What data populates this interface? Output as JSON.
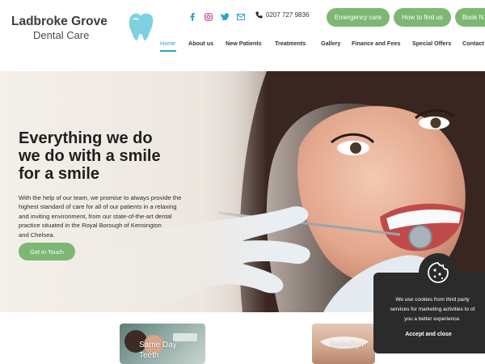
{
  "brand": {
    "name": "Ladbroke Grove",
    "subtitle": "Dental Care"
  },
  "social": [
    "facebook-icon",
    "instagram-icon",
    "twitter-icon",
    "email-icon"
  ],
  "phone": {
    "icon": "phone-icon",
    "number": "0207 727 9836"
  },
  "header_buttons": {
    "emergency": "Emergency care",
    "find": "How to find us",
    "book": "Book N"
  },
  "nav": [
    {
      "label": "Home",
      "active": true
    },
    {
      "label": "About us"
    },
    {
      "label": "New Patients"
    },
    {
      "label": "Treatments"
    },
    {
      "label": "Gallery"
    },
    {
      "label": "Finance and Fees"
    },
    {
      "label": "Special Offers"
    },
    {
      "label": "Contact"
    }
  ],
  "hero": {
    "title_lines": [
      "Everything we do",
      "we do with a smile",
      "for a smile"
    ],
    "text_lines": [
      "With the help of our team, we promise to always provide the",
      "highest standard of care for all of our patients in a relaxing",
      "and inviting environment, from our state-of-the-art dental",
      "practice situated in the Royal Borough of Kensington",
      "and Chelsea."
    ],
    "cta": "Get in Touch"
  },
  "cards": [
    {
      "label_lines": [
        "Same Day",
        "Teeth"
      ]
    },
    {
      "label_lines": [
        "Invisalign"
      ]
    }
  ],
  "cookie": {
    "icon": "cookie-icon",
    "text_lines": [
      "We use cookies from third party",
      "services for marketing activities to of",
      "you a better experience."
    ],
    "button": "Accept and close"
  },
  "colors": {
    "accent_green": "#7db773",
    "nav_active": "#2aa3c8",
    "cookie_bg": "#2b2b2b"
  }
}
